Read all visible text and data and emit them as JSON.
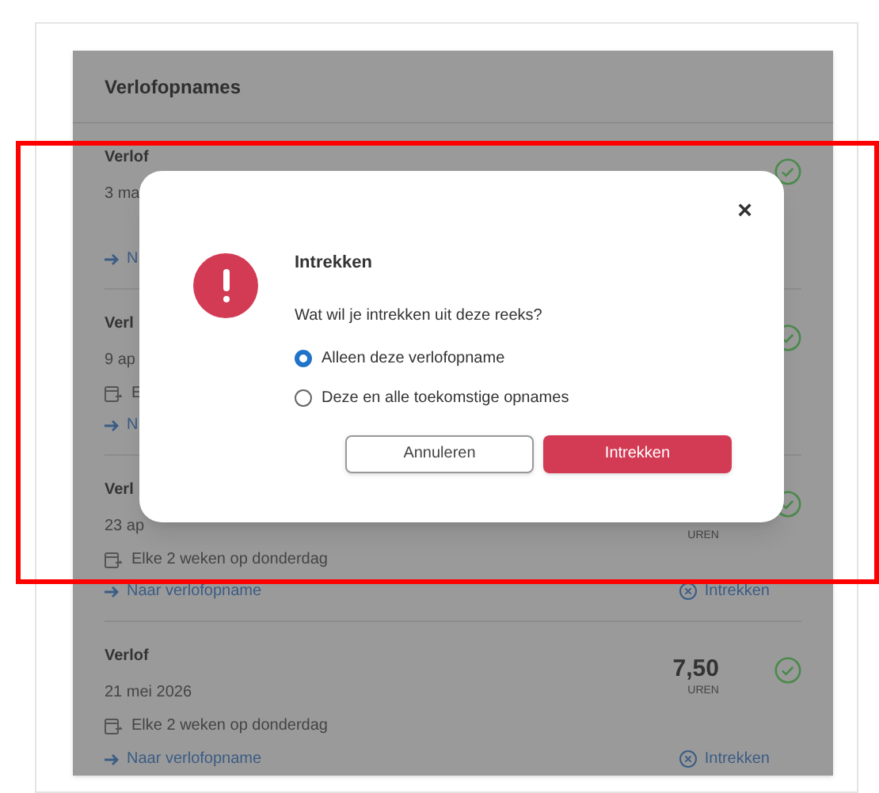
{
  "card": {
    "title": "Verlofopnames",
    "entries": [
      {
        "type": "Verlof",
        "date": "3 ma",
        "link": "N",
        "approved": true
      },
      {
        "type": "Verl",
        "date": "9 ap",
        "recurrence": "E",
        "link": "N",
        "approved": true
      },
      {
        "type": "Verl",
        "date": "23 ap",
        "recurrence": "Elke 2 weken op donderdag",
        "unit": "UREN",
        "link": "Naar verlofopname",
        "action": "Intrekken",
        "approved": true
      },
      {
        "type": "Verlof",
        "date": "21 mei 2026",
        "recurrence": "Elke 2 weken op donderdag",
        "hours": "7,50",
        "unit": "UREN",
        "link": "Naar verlofopname",
        "action": "Intrekken",
        "approved": true
      }
    ]
  },
  "dialog": {
    "close": "×",
    "title": "Intrekken",
    "question": "Wat wil je intrekken uit deze reeks?",
    "options": [
      {
        "label": "Alleen deze verlofopname",
        "selected": true
      },
      {
        "label": "Deze en alle toekomstige opnames",
        "selected": false
      }
    ],
    "buttons": [
      {
        "kind": "secondary",
        "label": "Annuleren"
      },
      {
        "kind": "primary",
        "label": "Intrekken"
      }
    ]
  }
}
